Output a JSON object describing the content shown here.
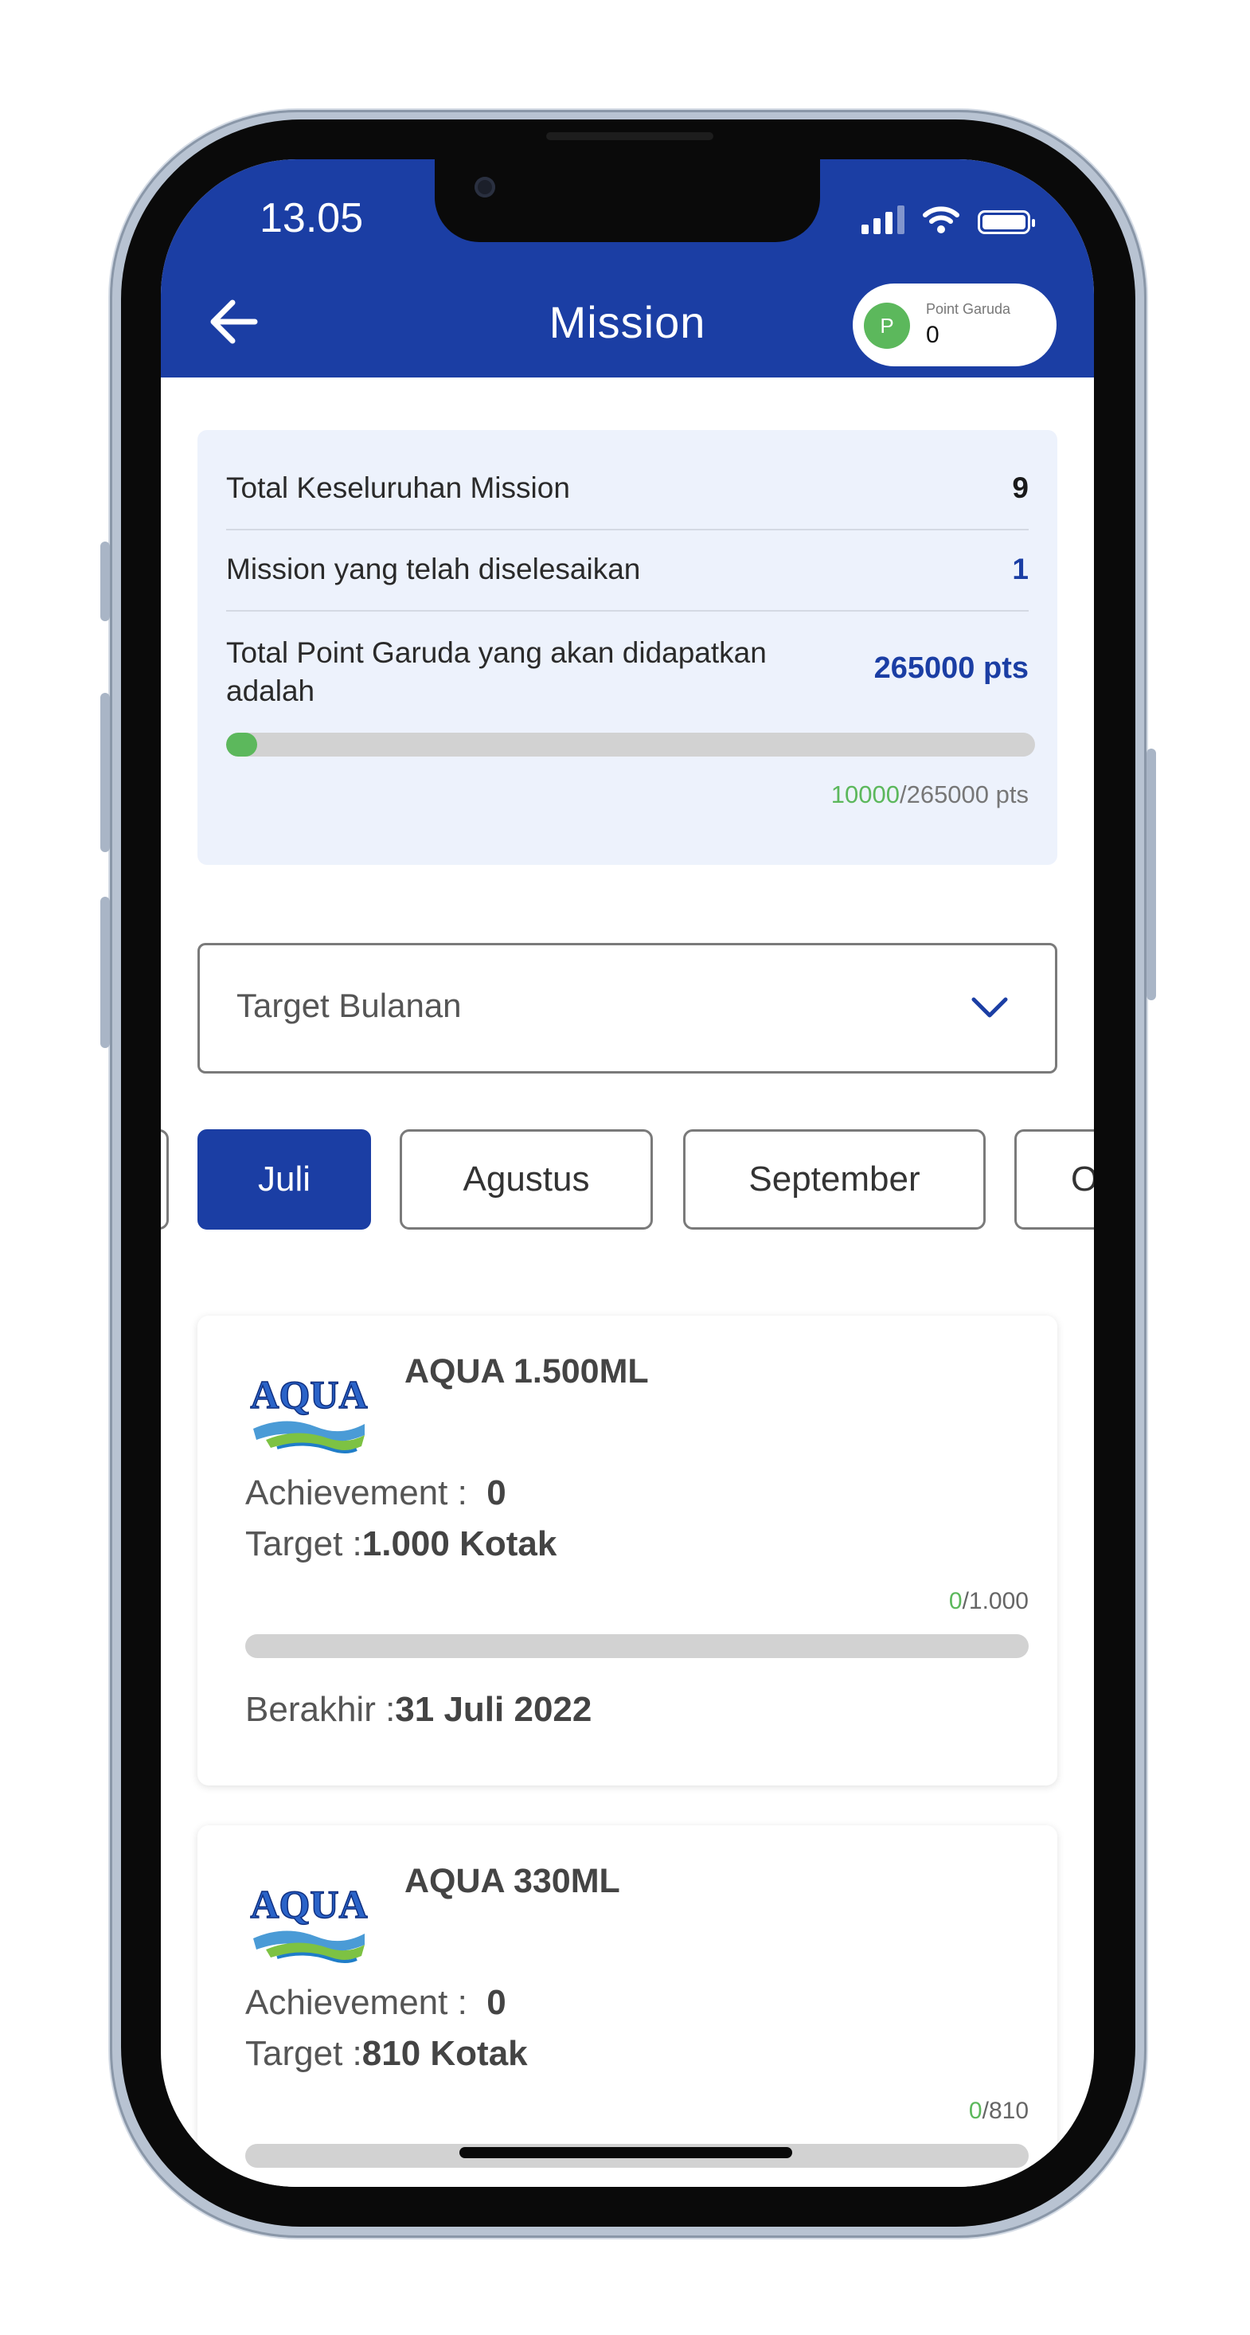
{
  "status_bar": {
    "time": "13.05"
  },
  "header": {
    "title": "Mission",
    "points": {
      "avatar_letter": "P",
      "label": "Point Garuda",
      "value": "0"
    }
  },
  "summary": {
    "rows": [
      {
        "label": "Total Keseluruhan Mission",
        "value": "9"
      },
      {
        "label": "Mission yang telah diselesaikan",
        "value": "1"
      },
      {
        "label": "Total Point Garuda yang akan didapatkan adalah",
        "value": "265000 pts"
      }
    ],
    "progress": {
      "current": "10000",
      "total_suffix": "/265000 pts",
      "fraction": 0.038
    }
  },
  "filter": {
    "selected": "Target Bulanan"
  },
  "months": {
    "items": [
      {
        "label": ""
      },
      {
        "label": "Juli"
      },
      {
        "label": "Agustus"
      },
      {
        "label": "September"
      },
      {
        "label": "O"
      }
    ],
    "active_index": 1
  },
  "missions": [
    {
      "title": "AQUA 1.500ML",
      "achievement_label": "Achievement :",
      "achievement_value": "0",
      "target_label": "Target :",
      "target_value": "1.000 Kotak",
      "progress_current": "0",
      "progress_total": "/1.000",
      "end_label": "Berakhir :",
      "end_value": "31 Juli 2022",
      "fraction": 0
    },
    {
      "title": "AQUA 330ML",
      "achievement_label": "Achievement :",
      "achievement_value": "0",
      "target_label": "Target :",
      "target_value": "810 Kotak",
      "progress_current": "0",
      "progress_total": "/810",
      "fraction": 0
    }
  ],
  "logo": {
    "text": "AQUA"
  },
  "colors": {
    "primary": "#1b3ea4",
    "accent_green": "#5cb85c",
    "card_bg": "#edf2fc",
    "track": "#d2d2d2"
  }
}
